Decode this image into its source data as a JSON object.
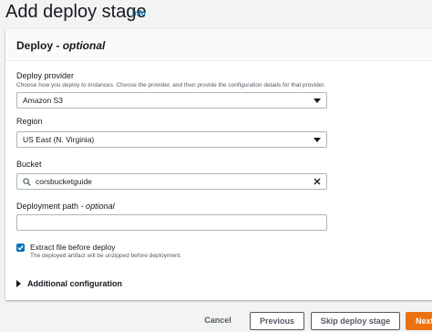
{
  "header": {
    "title": "Add deploy stage",
    "info": "Info"
  },
  "section": {
    "title": "Deploy",
    "title_optional": "- optional"
  },
  "provider": {
    "label": "Deploy provider",
    "description": "Choose how you deploy to instances. Choose the provider, and then provide the configuration details for that provider.",
    "value": "Amazon S3"
  },
  "region": {
    "label": "Region",
    "value": "US East (N. Virginia)"
  },
  "bucket": {
    "label": "Bucket",
    "value": "corsbucketguide"
  },
  "deployment_path": {
    "label": "Deployment path",
    "label_optional": "- optional",
    "value": ""
  },
  "extract": {
    "label": "Extract file before deploy",
    "description": "The deployed artifact will be unzipped before deployment.",
    "checked": true
  },
  "additional": {
    "label": "Additional configuration"
  },
  "footer": {
    "cancel": "Cancel",
    "previous": "Previous",
    "skip": "Skip deploy stage",
    "next": "Next"
  },
  "colors": {
    "accent": "#ec7211",
    "link": "#0073bb"
  }
}
